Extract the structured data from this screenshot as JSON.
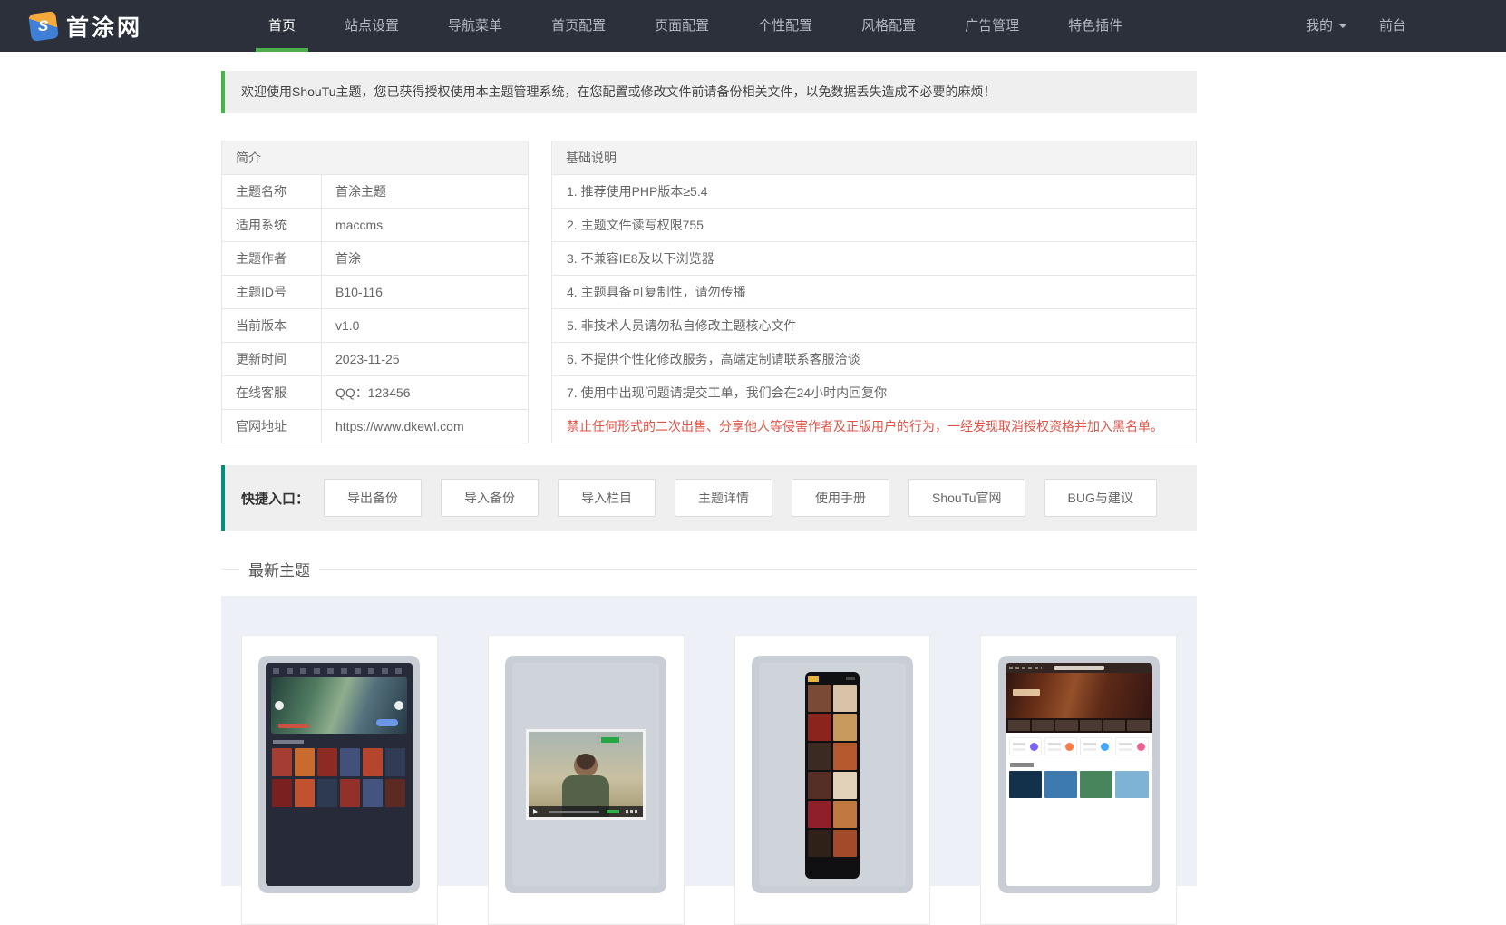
{
  "colors": {
    "navbar_bg": "#2b303b",
    "accent_green": "#44b549",
    "accent_teal": "#009178",
    "warning_red": "#e25147",
    "nav_active_underline": "#4cae4f"
  },
  "navbar": {
    "logo_letter": "S",
    "logo_text": "首涂网",
    "items": [
      {
        "label": "首页",
        "active": true
      },
      {
        "label": "站点设置"
      },
      {
        "label": "导航菜单"
      },
      {
        "label": "首页配置"
      },
      {
        "label": "页面配置"
      },
      {
        "label": "个性配置"
      },
      {
        "label": "风格配置"
      },
      {
        "label": "广告管理"
      },
      {
        "label": "特色插件"
      }
    ],
    "right": [
      {
        "label": "我的",
        "caret": true
      },
      {
        "label": "前台"
      }
    ]
  },
  "alert": {
    "text": "欢迎使用ShouTu主题，您已获得授权使用本主题管理系统，在您配置或修改文件前请备份相关文件，以免数据丢失造成不必要的麻烦！"
  },
  "intro_table": {
    "title": "简介",
    "rows": [
      [
        "主题名称",
        "首涂主题"
      ],
      [
        "适用系统",
        "maccms"
      ],
      [
        "主题作者",
        "首涂"
      ],
      [
        "主题ID号",
        "B10-116"
      ],
      [
        "当前版本",
        "v1.0"
      ],
      [
        "更新时间",
        "2023-11-25"
      ],
      [
        "在线客服",
        "QQ：123456"
      ],
      [
        "官网地址",
        "https://www.dkewl.com"
      ]
    ]
  },
  "notes_table": {
    "title": "基础说明",
    "rows": [
      "1. 推荐使用PHP版本≥5.4",
      "2. 主题文件读写权限755",
      "3. 不兼容IE8及以下浏览器",
      "4. 主题具备可复制性，请勿传播",
      "5. 非技术人员请勿私自修改主题核心文件",
      "6. 不提供个性化修改服务，高端定制请联系客服洽谈",
      "7. 使用中出现问题请提交工单，我们会在24小时内回复你"
    ],
    "warning": "禁止任何形式的二次出售、分享他人等侵害作者及正版用户的行为，一经发现取消授权资格并加入黑名单。"
  },
  "quick_entry": {
    "label": "快捷入口：",
    "buttons": [
      "导出备份",
      "导入备份",
      "导入栏目",
      "主题详情",
      "使用手册",
      "ShouTu官网",
      "BUG与建议"
    ]
  },
  "latest_themes": {
    "title": "最新主题",
    "cards": [
      {
        "id": "theme-card-1",
        "style": "desktop-dark-video-site"
      },
      {
        "id": "theme-card-2",
        "style": "video-player-page"
      },
      {
        "id": "theme-card-3",
        "style": "mobile-theme"
      },
      {
        "id": "theme-card-4",
        "style": "desktop-light-video-site"
      }
    ]
  }
}
